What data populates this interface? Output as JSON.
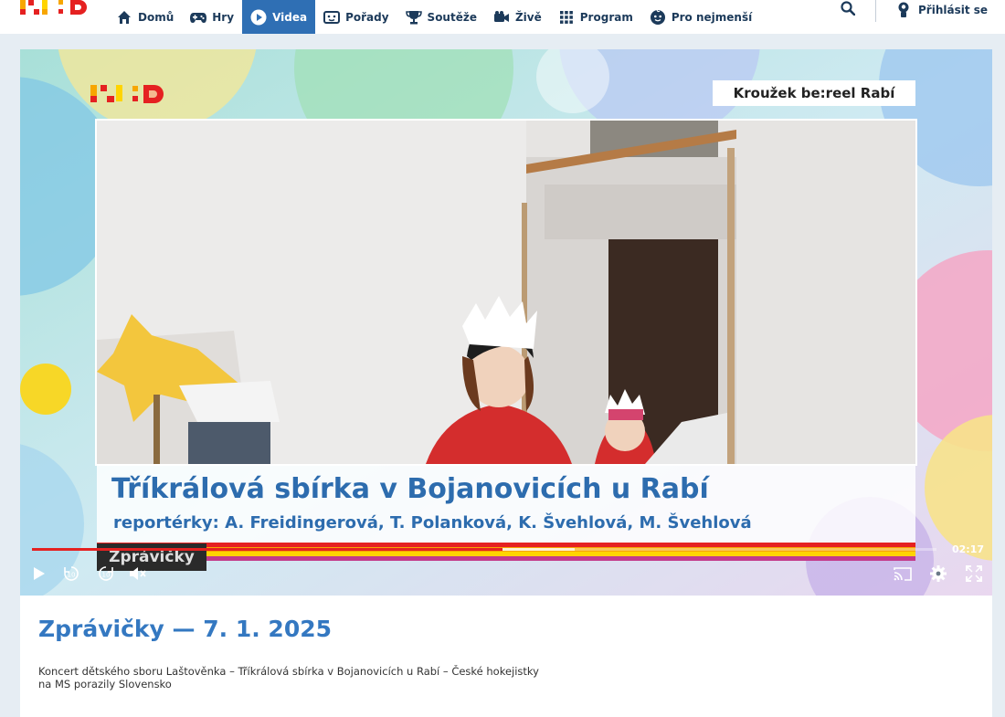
{
  "brand": {
    "logo_text": ":D",
    "colors": {
      "red": "#e52121",
      "orange": "#f7a600",
      "yellow": "#ffd400",
      "nav_blue": "#2f6fb4",
      "title_blue": "#3478c1"
    }
  },
  "nav": {
    "items": [
      {
        "label": "Domů",
        "icon": "home-icon",
        "active": false
      },
      {
        "label": "Hry",
        "icon": "gamepad-icon",
        "active": false
      },
      {
        "label": "Videa",
        "icon": "play-circle-icon",
        "active": true
      },
      {
        "label": "Pořady",
        "icon": "tv-icon",
        "active": false
      },
      {
        "label": "Soutěže",
        "icon": "trophy-icon",
        "active": false
      },
      {
        "label": "Živě",
        "icon": "live-camera-icon",
        "active": false
      },
      {
        "label": "Program",
        "icon": "grid-icon",
        "active": false
      },
      {
        "label": "Pro nejmenší",
        "icon": "baby-face-icon",
        "active": false
      }
    ],
    "search_icon": "search-icon",
    "login": {
      "label": "Přihlásit se",
      "icon": "user-icon"
    }
  },
  "player": {
    "show_label": "Kroužek be:reel Rabí",
    "headline": "Tříkrálová sbírka v Bojanovicích u Rabí",
    "reporters": "reportérky: A. Freidingerová, T. Polanková, K. Švehlová, M. Švehlová",
    "tag": "Zprávičky",
    "stripe_colors": [
      "#e52121",
      "#f7a600",
      "#ffd400",
      "#c33a8a"
    ],
    "progress": 0.52,
    "buffered": 0.6,
    "time_remaining": "02:17",
    "controls_left": [
      "play-icon",
      "rewind-10-icon",
      "forward-10-icon",
      "mute-icon"
    ],
    "controls_right": [
      "cast-icon",
      "settings-icon",
      "fullscreen-icon"
    ]
  },
  "video": {
    "title": "Zprávičky — 7. 1. 2025",
    "description": "Koncert dětského sboru Laštověnka – Tříkrálová sbírka v Bojanovicích u Rabí – České hokejistky na MS porazily Slovensko"
  }
}
